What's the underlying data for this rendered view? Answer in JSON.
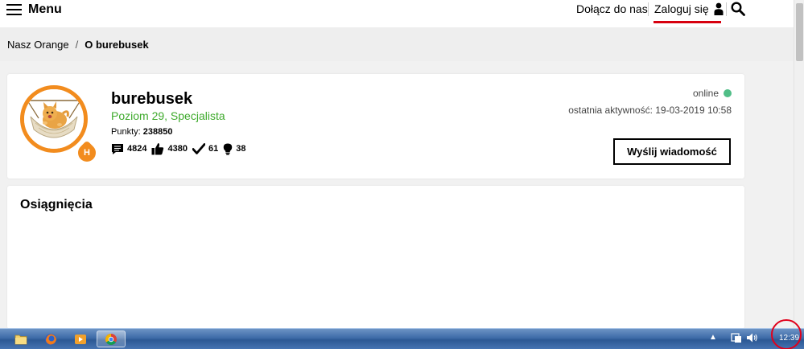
{
  "header": {
    "menu_label": "Menu",
    "join_label": "Dołącz do nas",
    "login_label": "Zaloguj się",
    "accent_color": "#d7000f"
  },
  "breadcrumb": {
    "parent": "Nasz Orange",
    "separator": "/",
    "current": "O burebusek"
  },
  "profile": {
    "username": "burebusek",
    "level": "Poziom 29, Specjalista",
    "level_badge": "H",
    "points_label": "Punkty:",
    "points_value": "238850",
    "stats": {
      "messages": "4824",
      "likes": "4380",
      "solutions": "61",
      "ideas": "38"
    },
    "status": "online",
    "status_color": "#50be87",
    "last_active": "ostatnia aktywność: 19-03-2019 10:58",
    "message_button": "Wyślij wiadomość",
    "avatar_ring_color": "#f28c1e"
  },
  "achievements": {
    "title": "Osiągnięcia"
  },
  "taskbar": {
    "apps": [
      "explorer-icon",
      "firefox-icon",
      "media-player-icon",
      "chrome-icon"
    ],
    "clock": "12:39"
  }
}
